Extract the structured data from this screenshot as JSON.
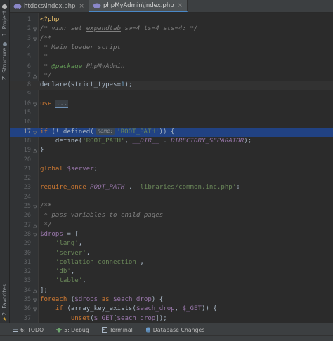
{
  "tabs": [
    {
      "label": "htdocs\\index.php",
      "active": false
    },
    {
      "label": "phpMyAdmin\\index.php",
      "active": true
    }
  ],
  "left_tools": {
    "project": "1: Project",
    "structure": "Z: Structure",
    "favorites": "2: Favorites"
  },
  "editor": {
    "highlighted_line": 17,
    "caret_line": 8,
    "lines": [
      {
        "n": "1",
        "tokens": [
          {
            "t": "tag",
            "v": "<?php"
          }
        ]
      },
      {
        "n": "2",
        "tokens": [
          {
            "t": "cmt",
            "v": "/* vim: set "
          },
          {
            "t": "cmtu",
            "v": "expandtab"
          },
          {
            "t": "cmt",
            "v": " sw=4 ts=4 sts=4: */"
          }
        ],
        "fold": "start"
      },
      {
        "n": "3",
        "tokens": [
          {
            "t": "cmt",
            "v": "/**"
          }
        ],
        "fold": "start"
      },
      {
        "n": "4",
        "tokens": [
          {
            "t": "cmt",
            "v": " * Main loader script"
          }
        ]
      },
      {
        "n": "5",
        "tokens": [
          {
            "t": "cmt",
            "v": " *"
          }
        ]
      },
      {
        "n": "6",
        "tokens": [
          {
            "t": "cmt",
            "v": " * "
          },
          {
            "t": "doctag",
            "v": "@package"
          },
          {
            "t": "cmt",
            "v": " PhpMyAdmin"
          }
        ]
      },
      {
        "n": "7",
        "tokens": [
          {
            "t": "cmt",
            "v": " */"
          }
        ],
        "fold": "end"
      },
      {
        "n": "8",
        "tokens": [
          {
            "t": "plain",
            "v": "declare(strict_types="
          },
          {
            "t": "num",
            "v": "1"
          },
          {
            "t": "plain",
            "v": ");"
          }
        ]
      },
      {
        "n": "9",
        "tokens": []
      },
      {
        "n": "10",
        "tokens": [
          {
            "t": "kw",
            "v": "use "
          },
          {
            "t": "ellipsis",
            "v": "..."
          }
        ],
        "fold": "start"
      },
      {
        "n": "15",
        "tokens": []
      },
      {
        "n": "16",
        "tokens": []
      },
      {
        "n": "17",
        "tokens": [
          {
            "t": "kw",
            "v": "if"
          },
          {
            "t": "plain",
            "v": " (! defined("
          },
          {
            "t": "hint",
            "v": "name:"
          },
          {
            "t": "str",
            "v": "'ROOT_PATH'"
          },
          {
            "t": "plain",
            "v": ")) {"
          }
        ],
        "fold": "start"
      },
      {
        "n": "18",
        "tokens": [
          {
            "t": "plain",
            "v": "    define("
          },
          {
            "t": "str",
            "v": "'ROOT_PATH'"
          },
          {
            "t": "plain",
            "v": ", "
          },
          {
            "t": "const",
            "v": "__DIR__"
          },
          {
            "t": "plain",
            "v": " . "
          },
          {
            "t": "const",
            "v": "DIRECTORY_SEPARATOR"
          },
          {
            "t": "plain",
            "v": ");"
          }
        ]
      },
      {
        "n": "19",
        "tokens": [
          {
            "t": "plain",
            "v": "}"
          }
        ],
        "fold": "end"
      },
      {
        "n": "20",
        "tokens": []
      },
      {
        "n": "21",
        "tokens": [
          {
            "t": "kw",
            "v": "global "
          },
          {
            "t": "var",
            "v": "$server"
          },
          {
            "t": "plain",
            "v": ";"
          }
        ]
      },
      {
        "n": "22",
        "tokens": []
      },
      {
        "n": "23",
        "tokens": [
          {
            "t": "kw",
            "v": "require_once "
          },
          {
            "t": "const",
            "v": "ROOT_PATH"
          },
          {
            "t": "plain",
            "v": " . "
          },
          {
            "t": "str",
            "v": "'libraries/common.inc.php'"
          },
          {
            "t": "plain",
            "v": ";"
          }
        ]
      },
      {
        "n": "24",
        "tokens": []
      },
      {
        "n": "25",
        "tokens": [
          {
            "t": "cmt",
            "v": "/**"
          }
        ],
        "fold": "start"
      },
      {
        "n": "26",
        "tokens": [
          {
            "t": "cmt",
            "v": " * pass variables to child pages"
          }
        ]
      },
      {
        "n": "27",
        "tokens": [
          {
            "t": "cmt",
            "v": " */"
          }
        ],
        "fold": "end"
      },
      {
        "n": "28",
        "tokens": [
          {
            "t": "var",
            "v": "$drops"
          },
          {
            "t": "plain",
            "v": " = ["
          }
        ],
        "fold": "start"
      },
      {
        "n": "29",
        "tokens": [
          {
            "t": "plain",
            "v": "    "
          },
          {
            "t": "str",
            "v": "'lang'"
          },
          {
            "t": "plain",
            "v": ","
          }
        ]
      },
      {
        "n": "30",
        "tokens": [
          {
            "t": "plain",
            "v": "    "
          },
          {
            "t": "str",
            "v": "'server'"
          },
          {
            "t": "plain",
            "v": ","
          }
        ]
      },
      {
        "n": "31",
        "tokens": [
          {
            "t": "plain",
            "v": "    "
          },
          {
            "t": "str",
            "v": "'collation_connection'"
          },
          {
            "t": "plain",
            "v": ","
          }
        ]
      },
      {
        "n": "32",
        "tokens": [
          {
            "t": "plain",
            "v": "    "
          },
          {
            "t": "str",
            "v": "'db'"
          },
          {
            "t": "plain",
            "v": ","
          }
        ]
      },
      {
        "n": "33",
        "tokens": [
          {
            "t": "plain",
            "v": "    "
          },
          {
            "t": "str",
            "v": "'table'"
          },
          {
            "t": "plain",
            "v": ","
          }
        ]
      },
      {
        "n": "34",
        "tokens": [
          {
            "t": "plain",
            "v": "];"
          }
        ],
        "fold": "end"
      },
      {
        "n": "35",
        "tokens": [
          {
            "t": "kw",
            "v": "foreach"
          },
          {
            "t": "plain",
            "v": " ("
          },
          {
            "t": "var",
            "v": "$drops"
          },
          {
            "t": "kw",
            "v": " as "
          },
          {
            "t": "var",
            "v": "$each_drop"
          },
          {
            "t": "plain",
            "v": ") {"
          }
        ],
        "fold": "start"
      },
      {
        "n": "36",
        "tokens": [
          {
            "t": "plain",
            "v": "    "
          },
          {
            "t": "kw",
            "v": "if"
          },
          {
            "t": "plain",
            "v": " (array_key_exists("
          },
          {
            "t": "var",
            "v": "$each_drop"
          },
          {
            "t": "plain",
            "v": ", "
          },
          {
            "t": "var",
            "v": "$_GET"
          },
          {
            "t": "plain",
            "v": ")) {"
          }
        ],
        "fold": "start"
      },
      {
        "n": "37",
        "tokens": [
          {
            "t": "plain",
            "v": "        "
          },
          {
            "t": "kw",
            "v": "unset"
          },
          {
            "t": "plain",
            "v": "("
          },
          {
            "t": "var",
            "v": "$_GET"
          },
          {
            "t": "plain",
            "v": "["
          },
          {
            "t": "var",
            "v": "$each_drop"
          },
          {
            "t": "plain",
            "v": "]);"
          }
        ]
      }
    ]
  },
  "bottom_tools": [
    {
      "label": "6: TODO",
      "icon": "todo-icon"
    },
    {
      "label": "5: Debug",
      "icon": "debug-icon"
    },
    {
      "label": "Terminal",
      "icon": "terminal-icon"
    },
    {
      "label": "Database Changes",
      "icon": "database-changes-icon"
    }
  ],
  "colors": {
    "editor_bg": "#2b2b2b",
    "selection": "#214283",
    "keyword": "#cc7832",
    "string": "#6a8759",
    "comment": "#808080",
    "variable": "#9876aa",
    "number": "#6897bb"
  }
}
